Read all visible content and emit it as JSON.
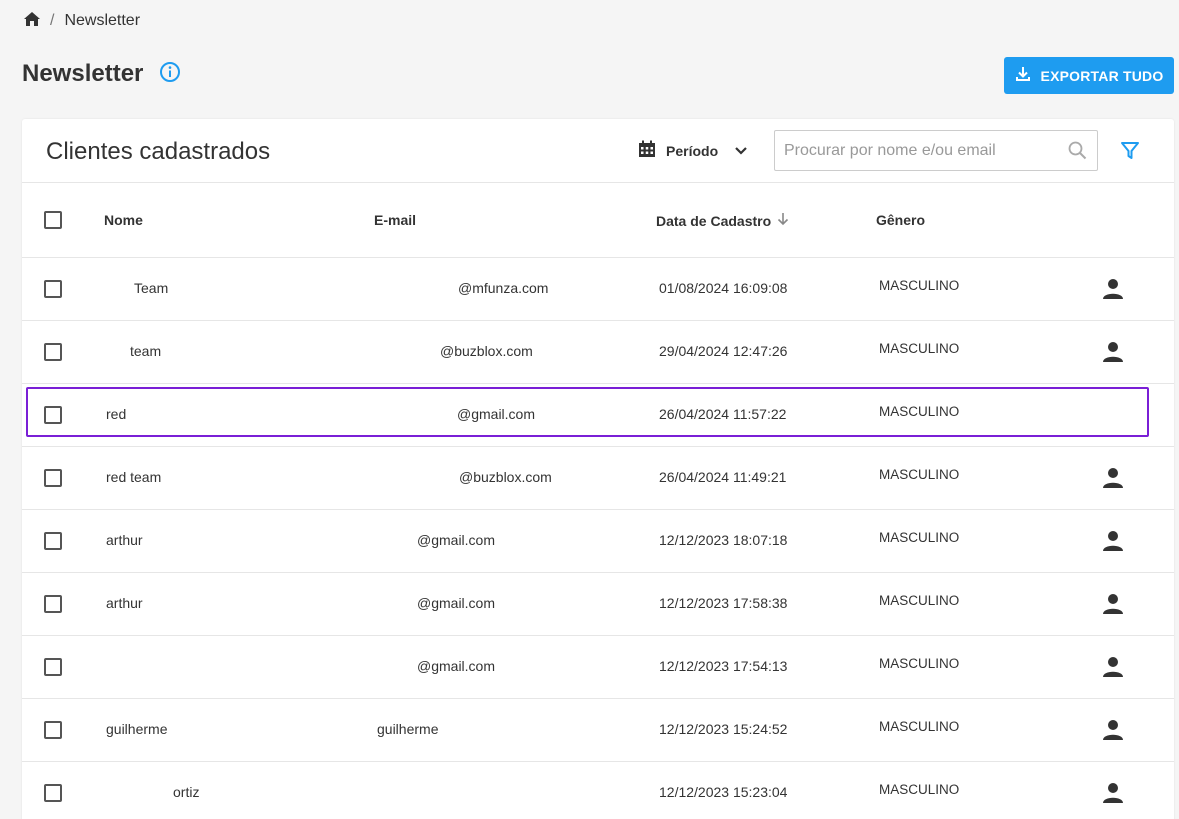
{
  "breadcrumb": {
    "separator": "/",
    "current": "Newsletter"
  },
  "page": {
    "title": "Newsletter"
  },
  "actions": {
    "export_label": "EXPORTAR TUDO"
  },
  "card": {
    "title": "Clientes cadastrados",
    "period_label": "Período",
    "search_placeholder": "Procurar por nome e/ou email"
  },
  "table": {
    "headers": {
      "name": "Nome",
      "email": "E-mail",
      "date": "Data de Cadastro",
      "gender": "Gênero"
    },
    "rows": [
      {
        "name": "Team",
        "email": "@mfunza.com",
        "date": "01/08/2024 16:09:08",
        "gender": "MASCULINO",
        "icon": "user-icon"
      },
      {
        "name": "team",
        "email": "@buzblox.com",
        "date": "29/04/2024 12:47:26",
        "gender": "MASCULINO",
        "icon": "user-icon"
      },
      {
        "name": "red",
        "email": "@gmail.com",
        "date": "26/04/2024 11:57:22",
        "gender": "MASCULINO",
        "icon": ""
      },
      {
        "name": "red team",
        "email": "@buzblox.com",
        "date": "26/04/2024 11:49:21",
        "gender": "MASCULINO",
        "icon": "user-icon"
      },
      {
        "name": "arthur",
        "email": "@gmail.com",
        "date": "12/12/2023 18:07:18",
        "gender": "MASCULINO",
        "icon": "user-icon"
      },
      {
        "name": "arthur",
        "email": "@gmail.com",
        "date": "12/12/2023 17:58:38",
        "gender": "MASCULINO",
        "icon": "user-icon"
      },
      {
        "name": "",
        "email": "@gmail.com",
        "date": "12/12/2023 17:54:13",
        "gender": "MASCULINO",
        "icon": "user-icon"
      },
      {
        "name": "guilherme",
        "email": "guilherme",
        "date": "12/12/2023 15:24:52",
        "gender": "MASCULINO",
        "icon": "user-icon"
      },
      {
        "name": "ortiz",
        "email": "",
        "date": "12/12/2023 15:23:04",
        "gender": "MASCULINO",
        "icon": "user-icon"
      }
    ]
  },
  "colors": {
    "accent": "#1e9cf0",
    "highlight": "#7a1fd6"
  }
}
